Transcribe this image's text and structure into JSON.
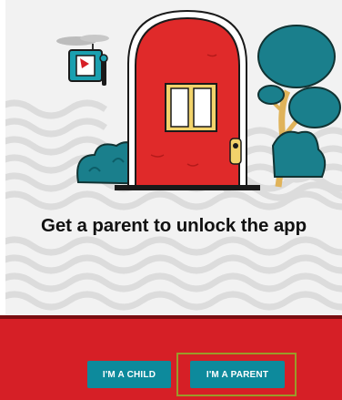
{
  "message": {
    "headline": "Get a parent to unlock the app"
  },
  "buttons": {
    "child_label": "I'M A CHILD",
    "parent_label": "I'M A PARENT"
  },
  "colors": {
    "bottom_bar": "#d61f26",
    "button": "#0d8a9c",
    "door": "#e02a2a",
    "tree": "#1a7f8c",
    "highlight_border": "#9a9a2a"
  },
  "icons": {
    "illustration": "red-door-illustration",
    "drone": "drone-icon",
    "tree": "tree-icon",
    "bush": "bush-icon"
  }
}
